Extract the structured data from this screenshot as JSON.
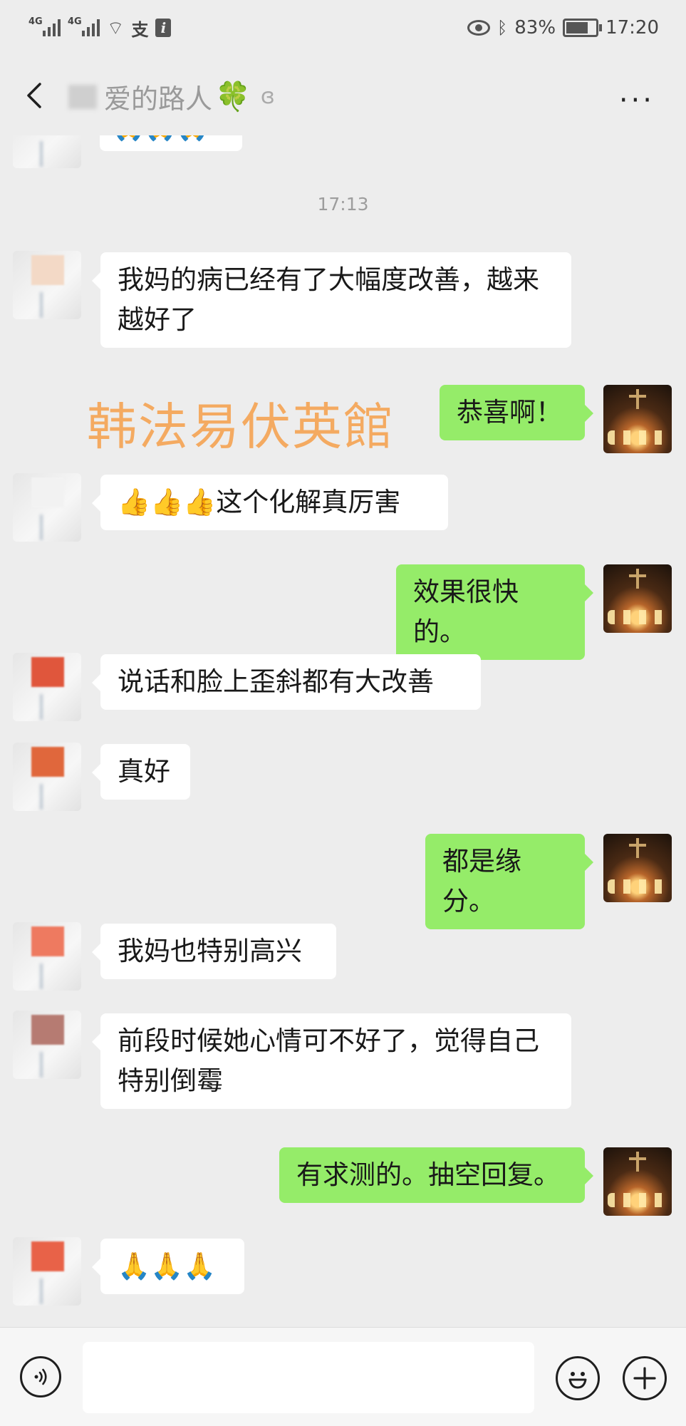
{
  "status_bar": {
    "network1": "4G",
    "network2": "4G",
    "pay_icon": "支",
    "info_icon": "i",
    "battery": "83%",
    "time": "17:20"
  },
  "header": {
    "title": "爱的路人",
    "clover": "🍀",
    "more": "···"
  },
  "chat": {
    "top_partial": "🙏🙏🙏",
    "timestamp": "17:13",
    "watermark": "韩法易伏英館",
    "messages": [
      {
        "side": "in",
        "text": "我妈的病已经有了大幅度改善，越来越好了"
      },
      {
        "side": "out",
        "text": "恭喜啊！"
      },
      {
        "side": "in",
        "text": "👍👍👍这个化解真厉害"
      },
      {
        "side": "out",
        "text": "效果很快的。"
      },
      {
        "side": "in",
        "text": "说话和脸上歪斜都有大改善"
      },
      {
        "side": "in",
        "text": "真好"
      },
      {
        "side": "out",
        "text": "都是缘分。"
      },
      {
        "side": "in",
        "text": "我妈也特别高兴"
      },
      {
        "side": "in",
        "text": "前段时候她心情可不好了，觉得自己特别倒霉"
      },
      {
        "side": "out",
        "text": "有求测的。抽空回复。"
      },
      {
        "side": "in",
        "text": "🙏🙏🙏"
      }
    ]
  },
  "colors": {
    "out_bubble": "#95ec69",
    "in_bubble": "#ffffff",
    "background": "#ededed",
    "watermark": "#f5a75a"
  },
  "input_bar": {
    "input_value": ""
  },
  "icons": [
    "back-icon",
    "ear-icon",
    "voice-icon",
    "emoji-icon",
    "plus-icon",
    "wifi-icon",
    "bluetooth-icon",
    "eye-icon",
    "battery-icon"
  ]
}
